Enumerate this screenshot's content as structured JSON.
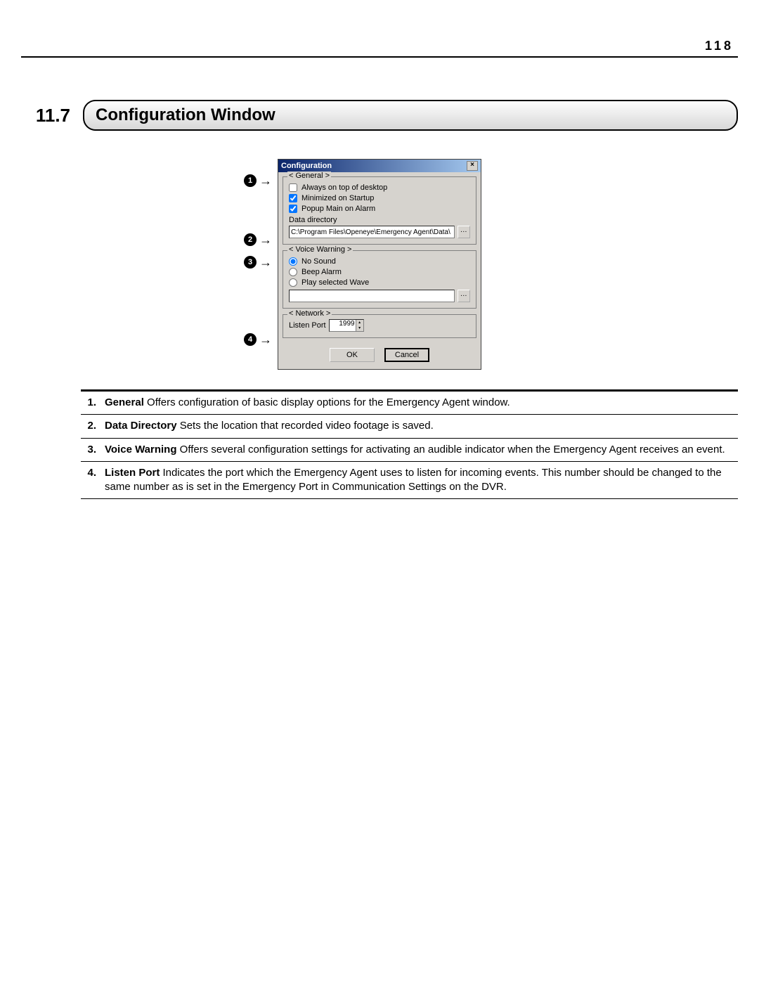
{
  "page_number": "118",
  "section": {
    "number": "11.7",
    "title": "Configuration Window"
  },
  "callouts": [
    "1",
    "2",
    "3",
    "4"
  ],
  "dialog": {
    "title": "Configuration",
    "general": {
      "label": "< General >",
      "always_on_top": {
        "label": "Always on top of desktop",
        "checked": false
      },
      "minimized": {
        "label": "Minimized on Startup",
        "checked": true
      },
      "popup": {
        "label": "Popup Main on Alarm",
        "checked": true
      },
      "data_dir_label": "Data directory",
      "data_dir_value": "C:\\Program Files\\Openeye\\Emergency Agent\\Data\\"
    },
    "voice": {
      "label": "< Voice Warning >",
      "no_sound": "No Sound",
      "beep": "Beep Alarm",
      "play_wave": "Play selected Wave",
      "selected": "no_sound",
      "wave_path": ""
    },
    "network": {
      "label": "< Network >",
      "listen_port_label": "Listen Port",
      "listen_port_value": "1999"
    },
    "ok": "OK",
    "cancel": "Cancel"
  },
  "descriptions": [
    {
      "n": "1.",
      "term": "General",
      "text": " Offers configuration of basic display options for the Emergency Agent window."
    },
    {
      "n": "2.",
      "term": "Data Directory",
      "text": " Sets the location that recorded video footage is saved."
    },
    {
      "n": "3.",
      "term": "Voice Warning",
      "text": " Offers several configuration settings for activating an audible indicator when the Emergency Agent receives an event."
    },
    {
      "n": "4.",
      "term": "Listen Port",
      "text": " Indicates the port which the Emergency Agent uses to listen for incoming events. This number should be changed to the same number as is set in the Emergency Port in Communication Settings on the DVR."
    }
  ]
}
